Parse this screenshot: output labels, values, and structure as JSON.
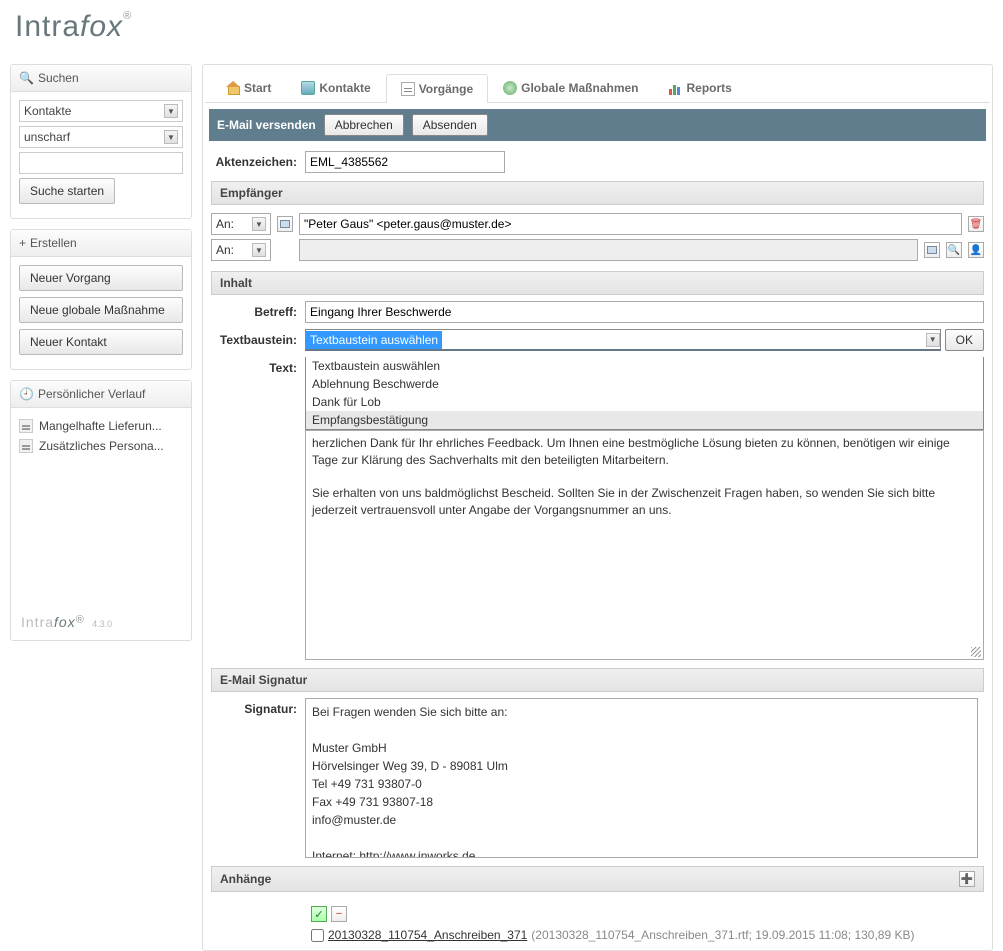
{
  "logo": {
    "part1": "Intra",
    "part2": "fox",
    "reg": "®"
  },
  "sidebar": {
    "search": {
      "title": "Suchen",
      "select1": "Kontakte",
      "select2": "unscharf",
      "input_value": "",
      "button": "Suche starten"
    },
    "create": {
      "title": "Erstellen",
      "items": [
        "Neuer Vorgang",
        "Neue globale Maßnahme",
        "Neuer Kontakt"
      ]
    },
    "history": {
      "title": "Persönlicher Verlauf",
      "items": [
        "Mangelhafte Lieferun...",
        "Zusätzliches Persona..."
      ]
    },
    "footer": {
      "text": "Intrafox",
      "version": "4.3.0"
    }
  },
  "tabs": {
    "items": [
      {
        "label": "Start"
      },
      {
        "label": "Kontakte"
      },
      {
        "label": "Vorgänge"
      },
      {
        "label": "Globale Maßnahmen"
      },
      {
        "label": "Reports"
      }
    ],
    "active": 2
  },
  "action_bar": {
    "title": "E-Mail versenden",
    "cancel": "Abbrechen",
    "send": "Absenden"
  },
  "form": {
    "aktenzeichen_label": "Aktenzeichen:",
    "aktenzeichen_value": "EML_4385562",
    "empfaenger_title": "Empfänger",
    "an_label": "An:",
    "recipient_value": "\"Peter Gaus\" <peter.gaus@muster.de>",
    "inhalt_title": "Inhalt",
    "betreff_label": "Betreff:",
    "betreff_value": "Eingang Ihrer Beschwerde",
    "textbaustein_label": "Textbaustein:",
    "textbaustein_selected": "Textbaustein auswählen",
    "textbaustein_options": [
      "Textbaustein auswählen",
      "Ablehnung Beschwerde",
      "Dank für Lob",
      "Empfangsbestätigung"
    ],
    "ok_button": "OK",
    "text_label": "Text:",
    "text_body_p1": "herzlichen Dank für Ihr ehrliches Feedback. Um Ihnen eine bestmögliche Lösung bieten zu können, benötigen wir einige Tage zur Klärung des Sachverhalts mit den beteiligten Mitarbeitern.",
    "text_body_p2": "Sie erhalten von uns baldmöglichst Bescheid. Sollten Sie in der Zwischenzeit Fragen haben, so wenden Sie sich bitte jederzeit vertrauensvoll unter Angabe der Vorgangsnummer an uns.",
    "signatur_title": "E-Mail Signatur",
    "signatur_label": "Signatur:",
    "signatur_lines": [
      "Bei Fragen wenden Sie sich bitte an:",
      "",
      "Muster GmbH",
      "Hörvelsinger Weg 39, D - 89081 Ulm",
      "Tel +49 731 93807-0",
      "Fax +49 731 93807-18",
      "info@muster.de",
      "",
      "Internet: http://www.inworks.de"
    ],
    "anhaenge_title": "Anhänge",
    "attachment": {
      "name": "20130328_110754_Anschreiben_371",
      "meta": "(20130328_110754_Anschreiben_371.rtf; 19.09.2015 11:08; 130,89 KB)"
    }
  }
}
